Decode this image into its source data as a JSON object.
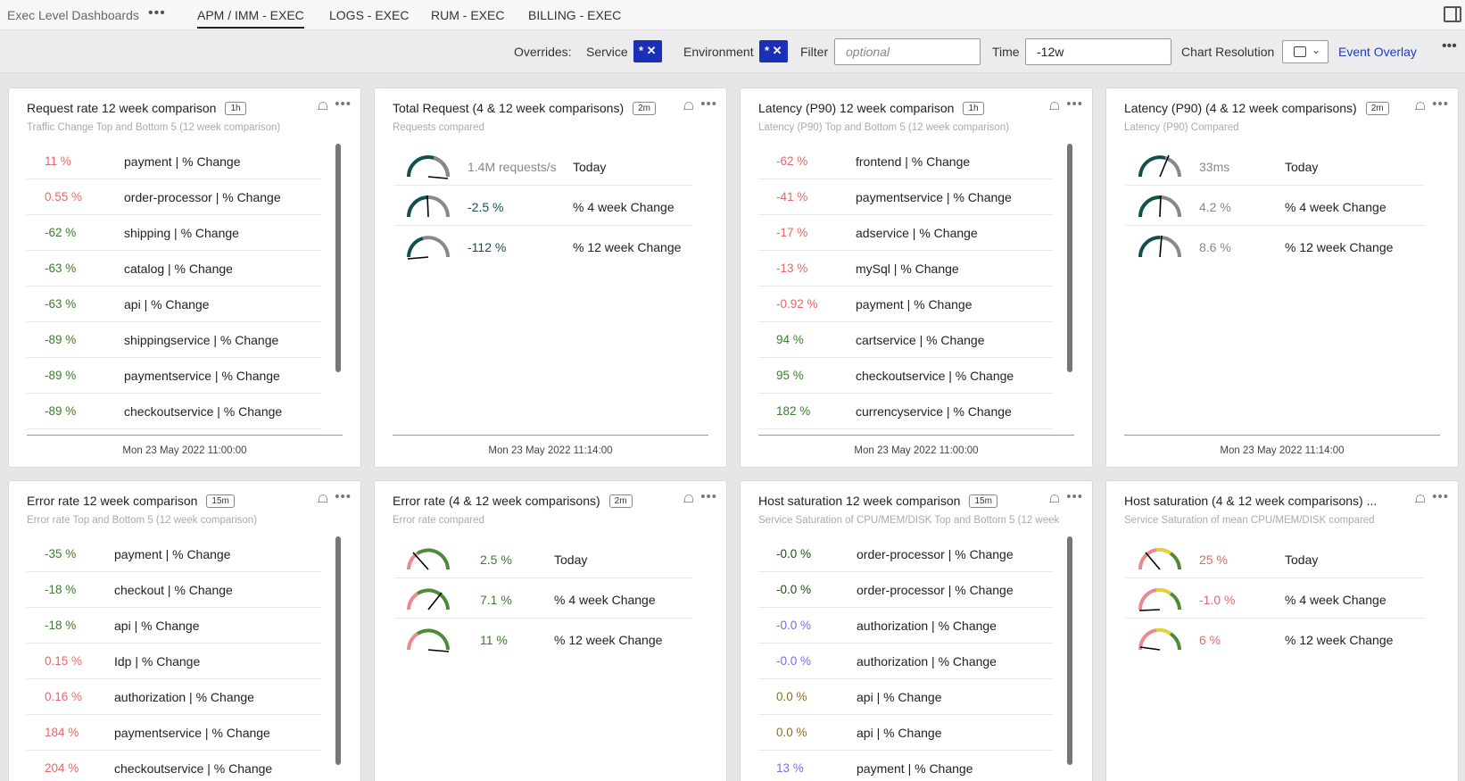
{
  "header": {
    "title": "Exec Level Dashboards",
    "tabs": [
      {
        "label": "APM / IMM - EXEC",
        "active": true
      },
      {
        "label": "LOGS - EXEC",
        "active": false
      },
      {
        "label": "RUM - EXEC",
        "active": false
      },
      {
        "label": "BILLING - EXEC",
        "active": false
      }
    ]
  },
  "filters": {
    "overrides_label": "Overrides:",
    "service_label": "Service",
    "service_chip": "* ✕",
    "environment_label": "Environment",
    "environment_chip": "* ✕",
    "filter_label": "Filter",
    "filter_placeholder": "optional",
    "time_label": "Time",
    "time_value": "-12w",
    "chart_resolution_label": "Chart Resolution",
    "event_overlay_label": "Event Overlay"
  },
  "colors": {
    "accent": "#1b3bc4",
    "chip": "#1b2fb8",
    "negative_red": "#e2686b",
    "positive_green": "#3e7b2c",
    "teal": "#11504f"
  },
  "cards": [
    {
      "title": "Request rate 12 week comparison",
      "badge": "1h",
      "subtitle": "Traffic Change Top and Bottom 5 (12 week comparison)",
      "footer": "Mon 23 May 2022 11:00:00",
      "rows": [
        {
          "value": "11 %",
          "label": "payment | % Change"
        },
        {
          "value": "0.55 %",
          "label": "order-processor | % Change"
        },
        {
          "value": "-62 %",
          "label": "shipping | % Change"
        },
        {
          "value": "-63 %",
          "label": "catalog | % Change"
        },
        {
          "value": "-63 %",
          "label": "api | % Change"
        },
        {
          "value": "-89 %",
          "label": "shippingservice | % Change"
        },
        {
          "value": "-89 %",
          "label": "paymentservice | % Change"
        },
        {
          "value": "-89 %",
          "label": "checkoutservice | % Change"
        }
      ]
    },
    {
      "title": "Total Request (4 & 12 week comparisons)",
      "badge": "2m",
      "subtitle": "Requests compared",
      "footer": "Mon 23 May 2022 11:14:00",
      "rows": [
        {
          "value": "1.4M requests/s",
          "label": "Today"
        },
        {
          "value": "-2.5 %",
          "label": "% 4 week Change"
        },
        {
          "value": "-112 %",
          "label": "% 12 week Change"
        }
      ]
    },
    {
      "title": "Latency (P90) 12 week comparison",
      "badge": "1h",
      "subtitle": "Latency (P90) Top and Bottom 5 (12 week comparison)",
      "footer": "Mon 23 May 2022 11:00:00",
      "rows": [
        {
          "value": "-62 %",
          "label": "frontend | % Change"
        },
        {
          "value": "-41 %",
          "label": "paymentservice | % Change"
        },
        {
          "value": "-17 %",
          "label": "adservice | % Change"
        },
        {
          "value": "-13 %",
          "label": "mySql | % Change"
        },
        {
          "value": "-0.92 %",
          "label": "payment | % Change"
        },
        {
          "value": "94 %",
          "label": "cartservice | % Change"
        },
        {
          "value": "95 %",
          "label": "checkoutservice | % Change"
        },
        {
          "value": "182 %",
          "label": "currencyservice | % Change"
        }
      ]
    },
    {
      "title": "Latency (P90) (4 & 12 week comparisons)",
      "badge": "2m",
      "subtitle": "Latency (P90) Compared",
      "footer": "Mon 23 May 2022 11:14:00",
      "rows": [
        {
          "value": "33ms",
          "label": "Today"
        },
        {
          "value": "4.2 %",
          "label": "% 4 week Change"
        },
        {
          "value": "8.6 %",
          "label": "% 12 week Change"
        }
      ]
    },
    {
      "title": "Error rate 12 week comparison",
      "badge": "15m",
      "subtitle": "Error rate Top and Bottom 5 (12 week comparison)",
      "rows": [
        {
          "value": "-35 %",
          "label": "payment | % Change"
        },
        {
          "value": "-18 %",
          "label": "checkout | % Change"
        },
        {
          "value": "-18 %",
          "label": "api | % Change"
        },
        {
          "value": "0.15 %",
          "label": "Idp | % Change"
        },
        {
          "value": "0.16 %",
          "label": "authorization | % Change"
        },
        {
          "value": "184 %",
          "label": "paymentservice | % Change"
        },
        {
          "value": "204 %",
          "label": "checkoutservice | % Change"
        }
      ]
    },
    {
      "title": "Error rate (4 & 12 week comparisons)",
      "badge": "2m",
      "subtitle": "Error rate compared",
      "rows": [
        {
          "value": "2.5 %",
          "label": "Today"
        },
        {
          "value": "7.1 %",
          "label": "% 4 week Change"
        },
        {
          "value": "11 %",
          "label": "% 12 week Change"
        }
      ]
    },
    {
      "title": "Host saturation 12 week comparison",
      "badge": "15m",
      "subtitle": "Service Saturation of CPU/MEM/DISK Top and Bottom 5 (12 week",
      "rows": [
        {
          "value": "-0.0 %",
          "label": "order-processor | % Change"
        },
        {
          "value": "-0.0 %",
          "label": "order-processor | % Change"
        },
        {
          "value": "-0.0 %",
          "label": "authorization | % Change"
        },
        {
          "value": "-0.0 %",
          "label": "authorization | % Change"
        },
        {
          "value": "0.0 %",
          "label": "api | % Change"
        },
        {
          "value": "0.0 %",
          "label": "api | % Change"
        },
        {
          "value": "13 %",
          "label": "payment | % Change"
        }
      ]
    },
    {
      "title": "Host saturation (4 & 12 week comparisons) ...",
      "subtitle": "Service Saturation of mean CPU/MEM/DISK compared",
      "rows": [
        {
          "value": "25 %",
          "label": "Today"
        },
        {
          "value": "-1.0 %",
          "label": "% 4 week Change"
        },
        {
          "value": "6 %",
          "label": "% 12 week Change"
        }
      ]
    }
  ]
}
